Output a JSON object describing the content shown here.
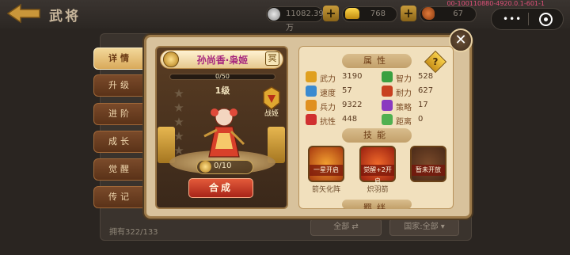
{
  "topbar": {
    "title": "武将",
    "resources": [
      {
        "icon": "silver-coin-icon",
        "value": "11082.39万"
      },
      {
        "icon": "gold-ingot-icon",
        "value": "768"
      },
      {
        "icon": "drumstick-icon",
        "value": "67"
      }
    ],
    "build_id": "00-100110880-4920.0.1-601-1"
  },
  "side_tabs": [
    {
      "label": "详情",
      "active": true
    },
    {
      "label": "升级",
      "active": false
    },
    {
      "label": "进阶",
      "active": false
    },
    {
      "label": "成长",
      "active": false
    },
    {
      "label": "觉醒",
      "active": false
    },
    {
      "label": "传记",
      "active": false
    }
  ],
  "background": {
    "owned": "拥有322/133",
    "btn_all": "全部",
    "btn_country": "国家:全部"
  },
  "hero": {
    "name": "孙尚香·枭姬",
    "book_icon": "冥",
    "progress_text": "0/50",
    "progress_fraction": 0.0,
    "level": "1级",
    "stars_total": 5,
    "stars_filled": 0,
    "role": "战姬",
    "fragments": "0/10",
    "compose_label": "合成"
  },
  "attributes": {
    "header": "属性",
    "stats": [
      {
        "icon": "sword-icon",
        "name": "武力",
        "value": "3190",
        "color": "#e0a020"
      },
      {
        "icon": "wisdom-icon",
        "name": "智力",
        "value": "528",
        "color": "#3aa040"
      },
      {
        "icon": "boot-icon",
        "name": "速度",
        "value": "57",
        "color": "#3a8ad0"
      },
      {
        "icon": "endurance-icon",
        "name": "耐力",
        "value": "627",
        "color": "#c84020"
      },
      {
        "icon": "troops-icon",
        "name": "兵力",
        "value": "9322",
        "color": "#e09020"
      },
      {
        "icon": "strategy-icon",
        "name": "策略",
        "value": "17",
        "color": "#8a3ac0"
      },
      {
        "icon": "resist-icon",
        "name": "抗性",
        "value": "448",
        "color": "#d03030"
      },
      {
        "icon": "range-icon",
        "name": "距离",
        "value": "0",
        "color": "#50b050"
      }
    ],
    "skills_header": "技能",
    "skills": [
      {
        "name": "箭矢化阵",
        "label": "一星开启",
        "colors": [
          "#f3a030",
          "#a83a10"
        ]
      },
      {
        "name": "炽羽箭",
        "label": "觉醒+2开启",
        "colors": [
          "#f06a2a",
          "#9a2010"
        ]
      },
      {
        "name": "",
        "label": "暂未开放",
        "colors": [
          "#7a4a2a",
          "#4a2a18"
        ]
      }
    ],
    "bottom_header": "羁绊"
  },
  "colors": {
    "accent": "#d9a95a",
    "frame": "#9c7a4a"
  }
}
